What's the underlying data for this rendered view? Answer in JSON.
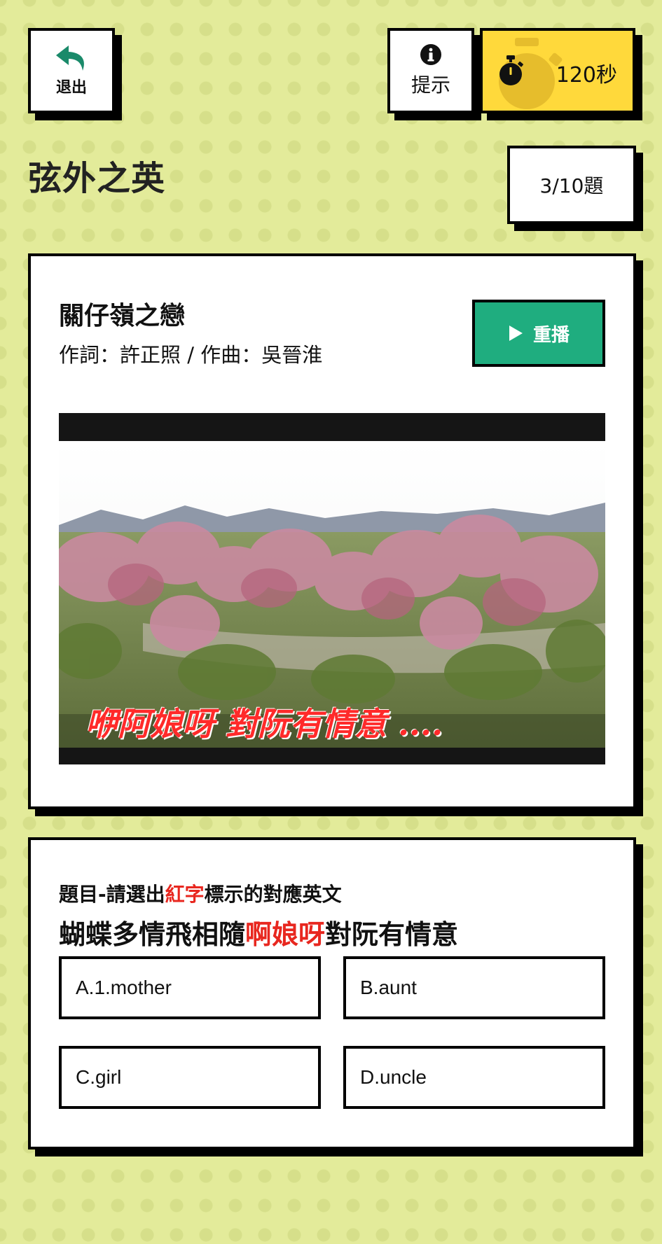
{
  "header": {
    "exit_label": "退出",
    "hint_label": "提示",
    "timer_value": "120秒"
  },
  "page_title": "弦外之英",
  "progress": "3/10題",
  "song": {
    "title": "關仔嶺之戀",
    "credits": "作詞：許正照 / 作曲：吳晉淮",
    "replay_label": "重播",
    "video_lyric": "咿阿娘呀 對阮有情意 ...."
  },
  "question": {
    "instruction_pre": "題目-請選出",
    "instruction_red": "紅字",
    "instruction_post": "標示的對應英文",
    "text_pre": "蝴蝶多情飛相隨",
    "text_red": "啊娘呀",
    "text_post": "對阮有情意",
    "options": [
      "A.1.mother",
      "B.aunt",
      "C.girl",
      "D.uncle"
    ]
  },
  "colors": {
    "background": "#e3eb9a",
    "timer": "#ffd93b",
    "replay": "#1fad7f",
    "highlight": "#e8271f"
  },
  "icons": {
    "exit": "undo-arrow-icon",
    "hint": "info-circle-icon",
    "timer": "stopwatch-icon",
    "replay": "play-icon"
  }
}
